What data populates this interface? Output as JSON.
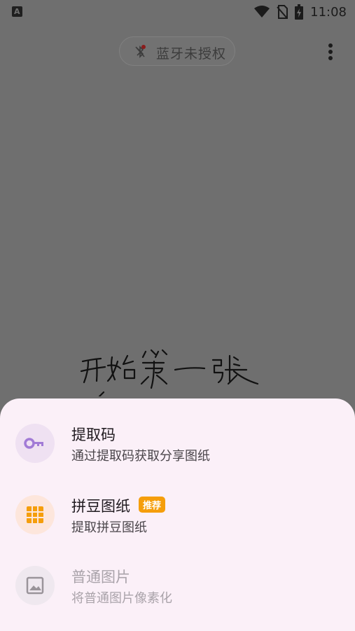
{
  "status_bar": {
    "time": "11:08",
    "notification_icon": "a-letter-icon"
  },
  "top": {
    "bluetooth_label": "蓝牙未授权",
    "bluetooth_icon": "bluetooth-off-icon",
    "menu_icon": "more-vert-icon"
  },
  "handwriting_text": "开始第一张",
  "sheet": {
    "items": [
      {
        "title": "提取码",
        "subtitle": "通过提取码获取分享图纸",
        "icon": "key-icon",
        "icon_color": "#a27bd6",
        "bg": "#efe1f2"
      },
      {
        "title": "拼豆图纸",
        "badge": "推荐",
        "subtitle": "提取拼豆图纸",
        "icon": "grid-icon",
        "icon_color": "#f59e0b",
        "bg": "#fde6dc"
      },
      {
        "title": "普通图片",
        "subtitle": "将普通图片像素化",
        "icon": "image-icon",
        "icon_color": "#9a949a",
        "bg": "#efe8ef"
      }
    ]
  },
  "colors": {
    "scrim": "#6f6f6f",
    "sheet_bg": "#fbf0f8",
    "badge": "#f59e0b"
  }
}
